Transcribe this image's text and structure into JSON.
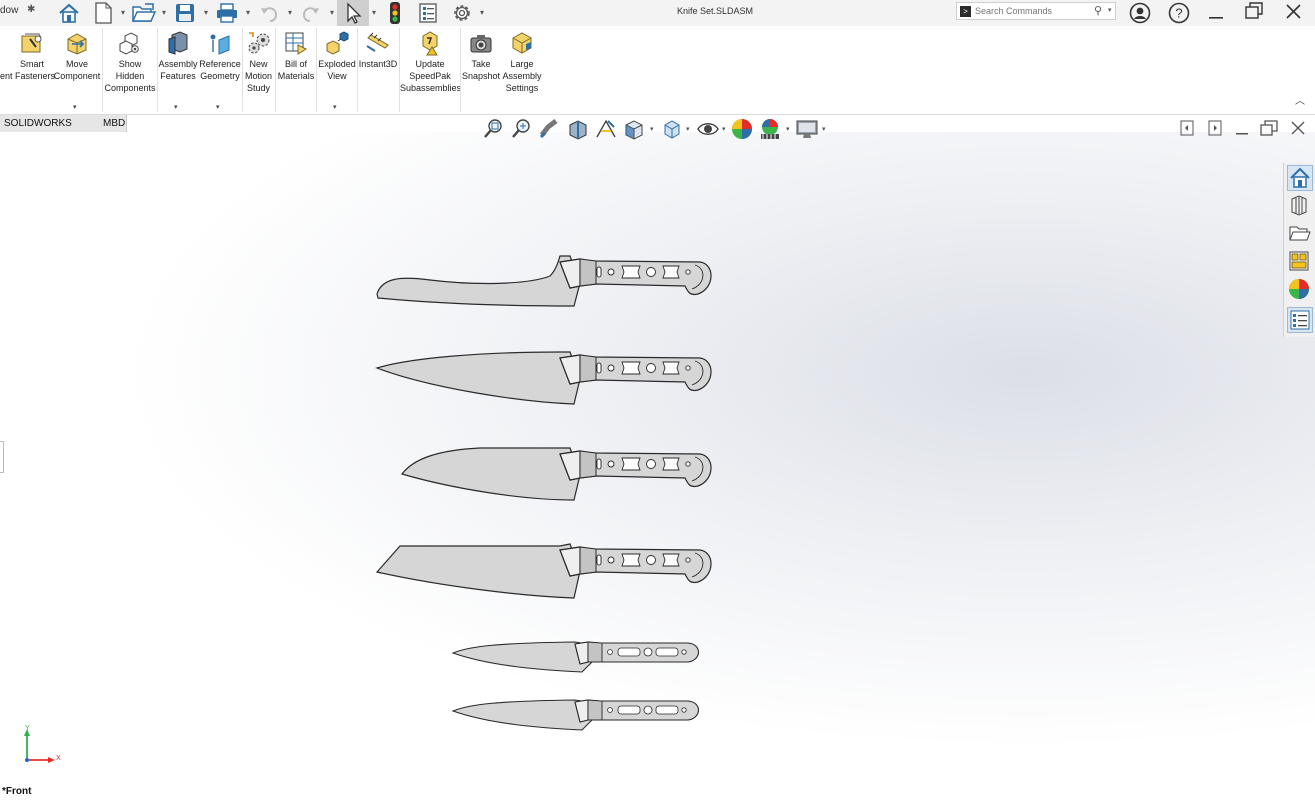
{
  "titlebar": {
    "menu_fragment": "dow",
    "pin_glyph": "✱",
    "document_title": "Knife Set.SLDASM",
    "search_placeholder": "Search Commands",
    "icons": [
      "home-icon",
      "new-document-icon",
      "open-icon",
      "save-icon",
      "print-icon",
      "undo-icon",
      "redo-icon",
      "select-icon",
      "rebuild-icon",
      "file-properties-icon",
      "options-icon",
      "user-account-icon",
      "help-icon"
    ],
    "window_controls": [
      "minimize",
      "restore",
      "close"
    ]
  },
  "ribbon": {
    "buttons": [
      {
        "label": "ent Fasteners",
        "icon": "smart-fasteners-icon"
      },
      {
        "label": "Smart",
        "icon": "smart-fasteners-icon"
      },
      {
        "label": "Move\nComponent",
        "icon": "move-component-icon"
      },
      {
        "label": "Show\nHidden\nComponents",
        "icon": "show-hidden-components-icon"
      },
      {
        "label": "Assembly\nFeatures",
        "icon": "assembly-features-icon"
      },
      {
        "label": "Reference\nGeometry",
        "icon": "reference-geometry-icon"
      },
      {
        "label": "New\nMotion\nStudy",
        "icon": "motion-study-icon"
      },
      {
        "label": "Bill of\nMaterials",
        "icon": "bill-of-materials-icon"
      },
      {
        "label": "Exploded\nView",
        "icon": "exploded-view-icon"
      },
      {
        "label": "Instant3D",
        "icon": "instant3d-icon"
      },
      {
        "label": "Update\nSpeedPak\nSubassemblies",
        "icon": "speedpak-icon"
      },
      {
        "label": "Take\nSnapshot",
        "icon": "camera-icon"
      },
      {
        "label": "Large\nAssembly\nSettings",
        "icon": "large-assembly-icon"
      }
    ]
  },
  "tabs": [
    "SOLIDWORKS Add-Ins",
    "MBD"
  ],
  "viewport": {
    "view_orientation": "*Front",
    "triad_axes": {
      "y": "Y",
      "x": "X"
    },
    "colors": {
      "knife_fill": "#d6d6d6",
      "knife_stroke": "#2a2a2a",
      "accent": "#2a7ab8"
    }
  },
  "taskpane": {
    "items": [
      "solidworks-resources-icon",
      "design-library-icon",
      "file-explorer-icon",
      "view-palette-icon",
      "appearances-icon",
      "custom-properties-icon"
    ]
  },
  "assembly": {
    "components": [
      "knife-1",
      "knife-2",
      "knife-3",
      "knife-4",
      "knife-5",
      "knife-6"
    ]
  }
}
